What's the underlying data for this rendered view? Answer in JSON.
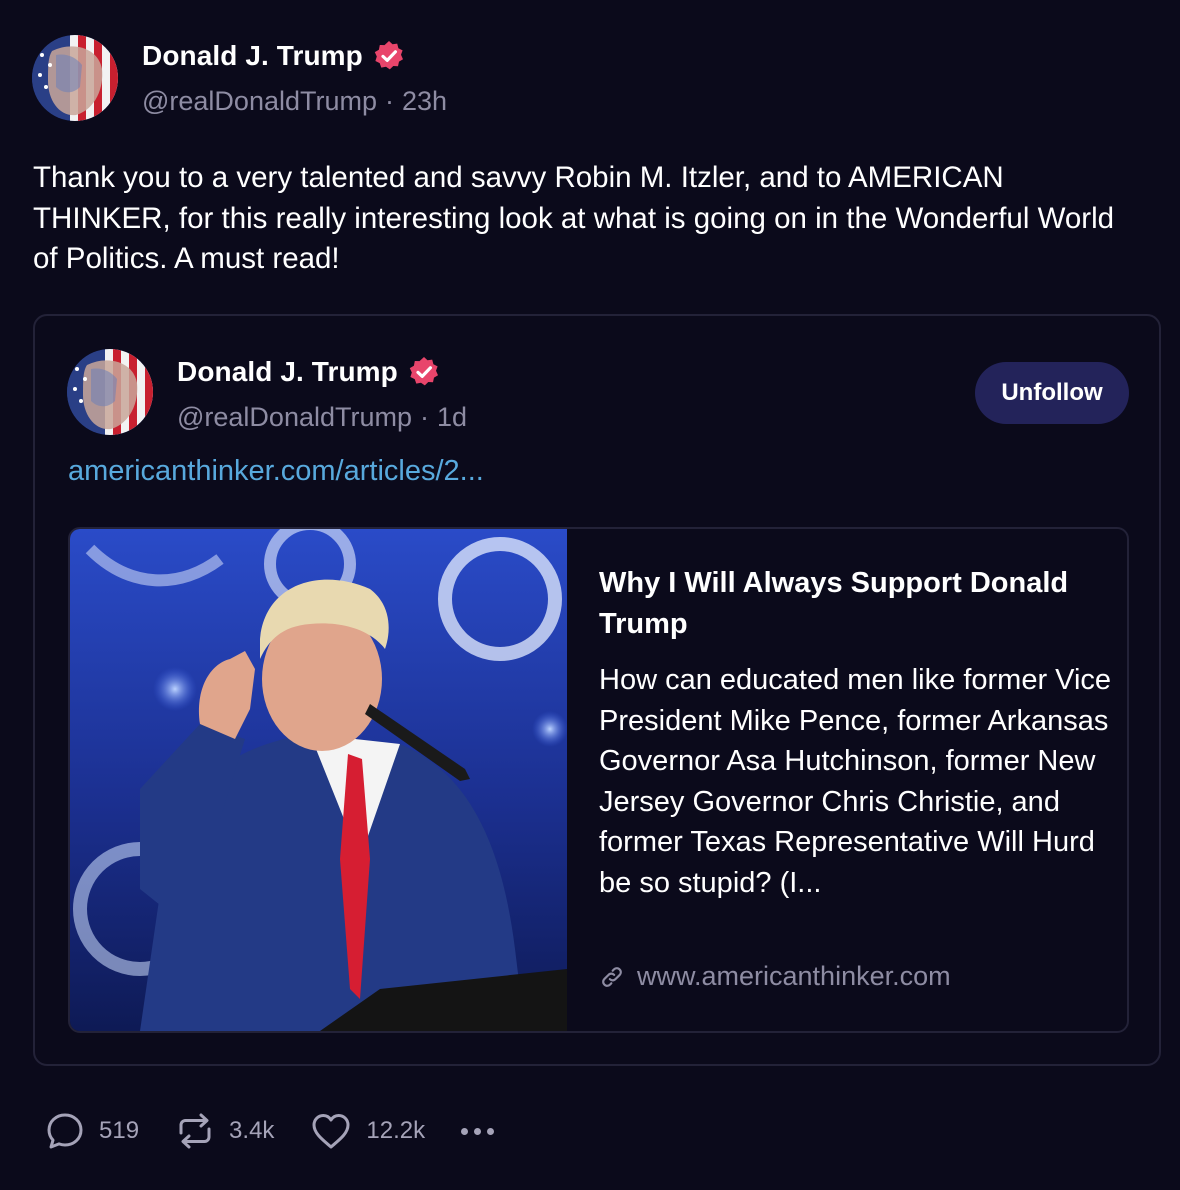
{
  "post": {
    "author_name": "Donald J. Trump",
    "handle": "@realDonaldTrump",
    "separator": "·",
    "time": "23h",
    "text": "Thank you to a very talented and savvy Robin M. Itzler, and to AMERICAN THINKER, for this really interesting look at what is going on in the Wonderful World of Politics. A must read!"
  },
  "quoted": {
    "author_name": "Donald J. Trump",
    "handle": "@realDonaldTrump",
    "separator": "·",
    "time": "1d",
    "unfollow_label": "Unfollow",
    "link_text": "americanthinker.com/articles/2...",
    "link_card": {
      "title": "Why I Will Always Support Donald Trump",
      "description": "How can educated men like former Vice President Mike Pence, former Arkansas Governor Asa Hutchinson, former New Jersey Governor Chris Christie, and former Texas Representative Will Hurd be so stupid? (I...",
      "domain": "www.americanthinker.com"
    }
  },
  "actions": {
    "replies": "519",
    "reposts": "3.4k",
    "likes": "12.2k"
  },
  "icons": {
    "verified": "verified-badge-icon",
    "reply": "comment-icon",
    "repost": "repost-icon",
    "like": "heart-icon",
    "more": "more-icon",
    "link": "link-icon"
  },
  "colors": {
    "background": "#0b0a1b",
    "verified": "#e8456b",
    "link": "#58a9dd",
    "muted": "#8e8ca3",
    "button": "#23235a"
  }
}
